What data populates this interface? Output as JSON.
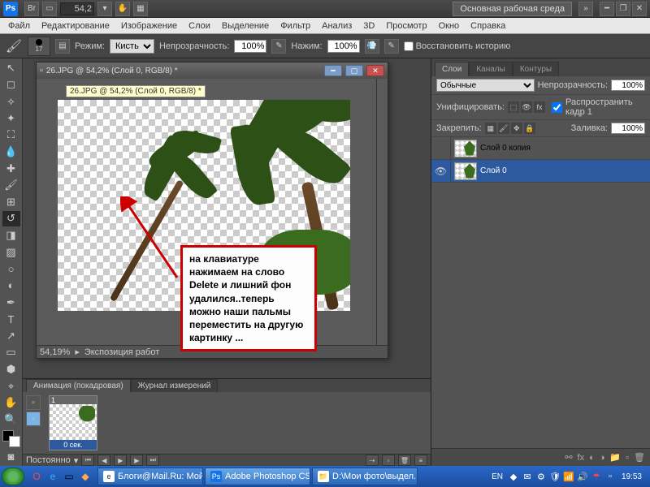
{
  "topbar": {
    "zoom": "54,2",
    "workspace": "Основная рабочая среда"
  },
  "menu": [
    "Файл",
    "Редактирование",
    "Изображение",
    "Слои",
    "Выделение",
    "Фильтр",
    "Анализ",
    "3D",
    "Просмотр",
    "Окно",
    "Справка"
  ],
  "optbar": {
    "brush_size": "17",
    "mode_label": "Режим:",
    "mode_value": "Кисть",
    "opacity_label": "Непрозрачность:",
    "opacity_value": "100%",
    "flow_label": "Нажим:",
    "flow_value": "100%",
    "restore_label": "Восстановить историю"
  },
  "doc": {
    "title": "26.JPG @ 54,2% (Слой 0, RGB/8) *",
    "tooltip": "26.JPG @ 54,2% (Слой 0, RGB/8) *",
    "status_zoom": "54,19%",
    "status_text": "Экспозиция работ"
  },
  "annotation": "на клавиатуре нажимаем на слово Delete и лишний фон удалился..теперь можно наши пальмы переместить на другую картинку ...",
  "animation": {
    "tab1": "Анимация (покадровая)",
    "tab2": "Журнал измерений",
    "frame_num": "1",
    "frame_time": "0 сек.",
    "loop": "Постоянно"
  },
  "layers_panel": {
    "tab_layers": "Слои",
    "tab_channels": "Каналы",
    "tab_paths": "Контуры",
    "blend": "Обычные",
    "opacity_label": "Непрозрачность:",
    "opacity_value": "100%",
    "unify_label": "Унифицировать:",
    "propagate_label": "Распространить кадр 1",
    "lock_label": "Закрепить:",
    "fill_label": "Заливка:",
    "fill_value": "100%",
    "layers": [
      {
        "name": "Слой 0 копия",
        "visible": false,
        "selected": false
      },
      {
        "name": "Слой 0",
        "visible": true,
        "selected": true
      }
    ]
  },
  "taskbar": {
    "tasks": [
      {
        "label": "Блоги@Mail.Ru: Мой ...",
        "ico": "e"
      },
      {
        "label": "Adobe Photoshop CS...",
        "ico": "Ps"
      },
      {
        "label": "D:\\Мои фото\\выдел...",
        "ico": "📁"
      }
    ],
    "lang": "EN",
    "clock": "19:53"
  }
}
